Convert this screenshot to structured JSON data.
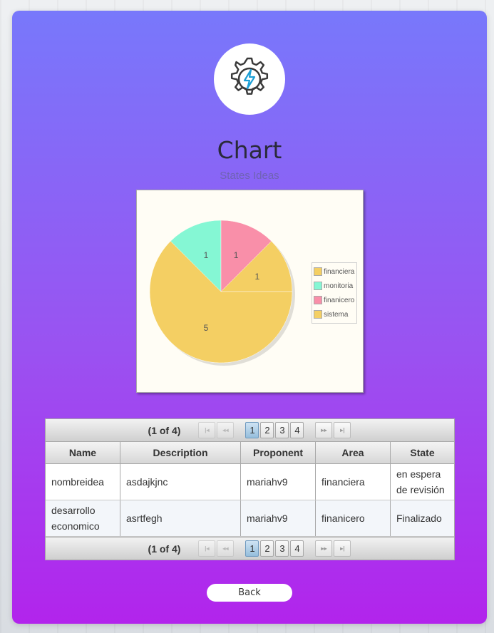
{
  "page": {
    "title": "Chart",
    "subtitle": "States Ideas",
    "logo": "gear-bolt-icon"
  },
  "chart_data": {
    "type": "pie",
    "title": "",
    "slices": [
      {
        "label": "financiera",
        "value": 1,
        "color": "#f4cf63"
      },
      {
        "label": "monitoria",
        "value": 1,
        "color": "#85f7d4"
      },
      {
        "label": "finanicero",
        "value": 1,
        "color": "#f98fa9"
      },
      {
        "label": "sistema",
        "value": 5,
        "color": "#f4cf63"
      }
    ],
    "legend_position": "right"
  },
  "table": {
    "page_report": "(1 of 4)",
    "pages": [
      "1",
      "2",
      "3",
      "4"
    ],
    "current_page": "1",
    "columns": [
      "Name",
      "Description",
      "Proponent",
      "Area",
      "State"
    ],
    "rows": [
      [
        "nombreidea",
        "asdajkjnc",
        "mariahv9",
        "financiera",
        "en espera de revisión"
      ],
      [
        "desarrollo economico",
        "asrtfegh",
        "mariahv9",
        "finanicero",
        "Finalizado"
      ]
    ]
  },
  "back_label": "Back"
}
